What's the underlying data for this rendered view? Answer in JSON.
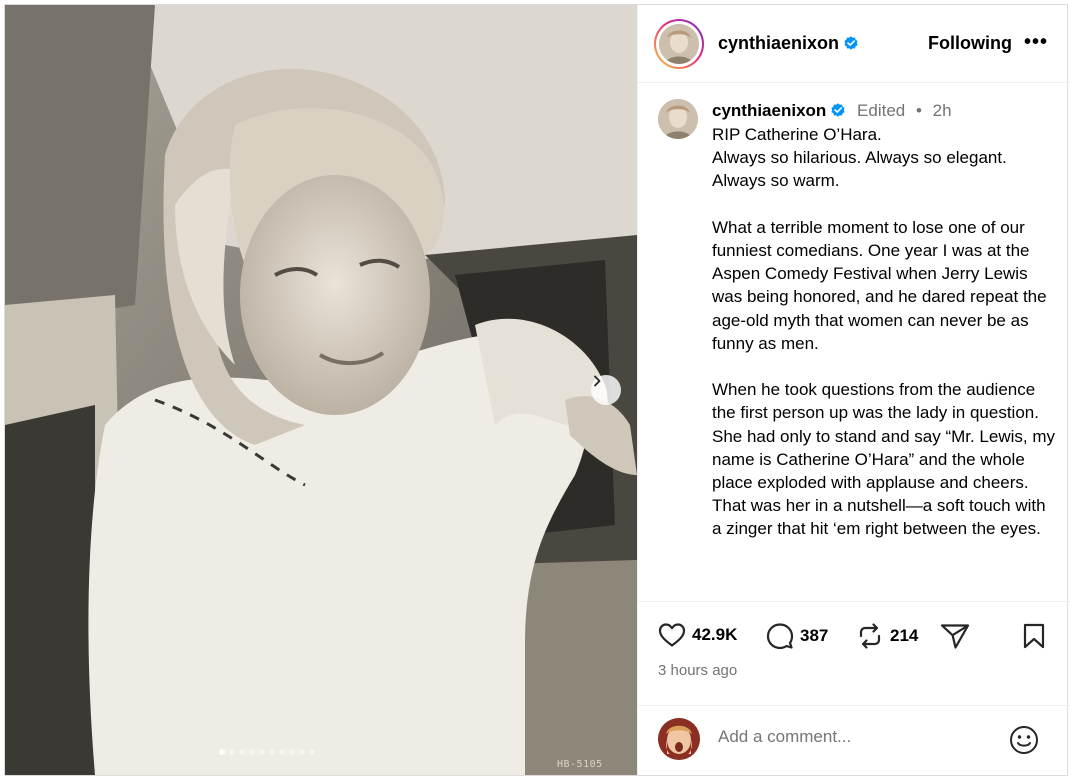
{
  "post": {
    "photo_stamp": "HB-5105",
    "carousel": {
      "total": 10,
      "active": 1
    }
  },
  "header": {
    "username": "cynthiaenixon",
    "verified": true,
    "follow_label": "Following",
    "more_label": "•••"
  },
  "caption": {
    "username": "cynthiaenixon",
    "edited_label": "Edited",
    "separator": "•",
    "time": "2h",
    "text": "RIP Catherine O’Hara.\nAlways so hilarious. Always so elegant. Always so warm.\n\nWhat a terrible moment to lose one of our funniest comedians. One year I was at the Aspen Comedy Festival when Jerry Lewis was being honored, and he dared repeat the age-old myth that women can never be as funny as men.\n\nWhen he took questions from the audience the first person up was the lady in question.\nShe had only to stand and say “Mr. Lewis, my name is Catherine O’Hara” and the whole place exploded with applause and cheers. That was her in a nutshell—a soft touch with a zinger that hit ‘em right between the eyes."
  },
  "actions": {
    "likes": "42.9K",
    "comments": "387",
    "reposts": "214",
    "time_ago": "3 hours ago"
  },
  "comment_box": {
    "placeholder": "Add a comment..."
  },
  "icons": {
    "like": "heart-icon",
    "comment": "speech-bubble-icon",
    "repost": "repost-icon",
    "share": "paper-plane-icon",
    "save": "bookmark-icon",
    "emoji": "smiley-icon",
    "verified": "verified-badge-icon",
    "next": "chevron-right-icon"
  },
  "colors": {
    "verified_blue": "#0095f6",
    "muted_text": "#737373",
    "divider": "#efefef"
  }
}
